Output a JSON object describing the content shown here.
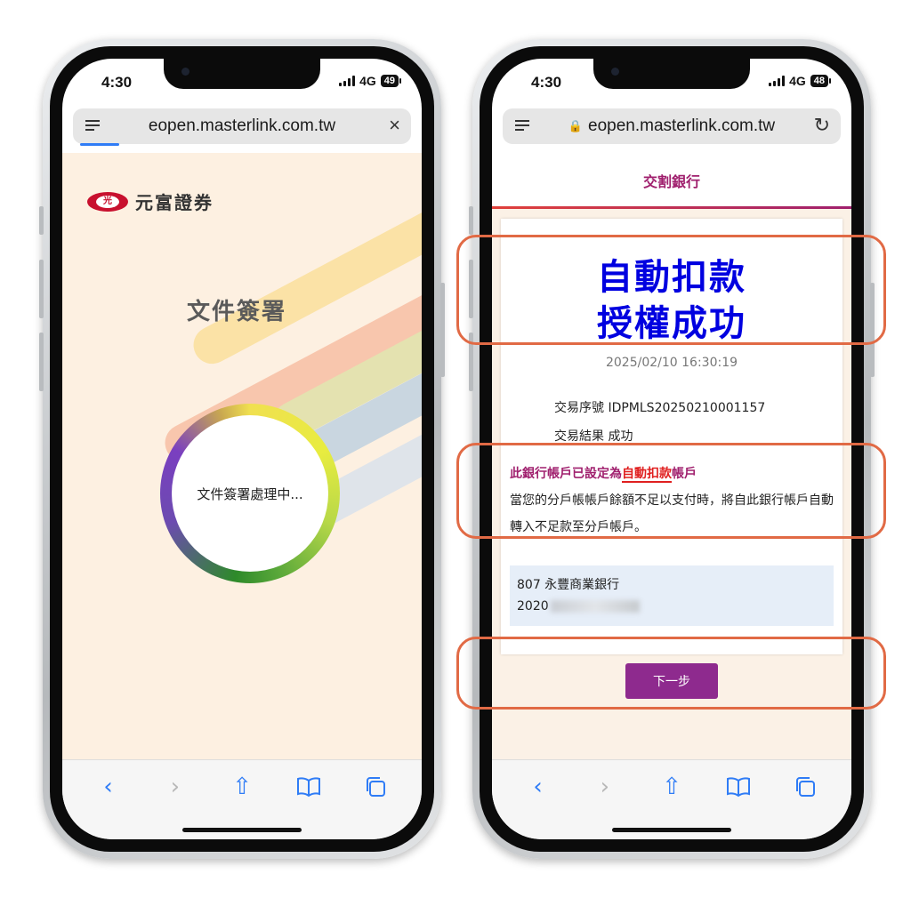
{
  "left": {
    "time": "4:30",
    "network": "4G",
    "battery": "49",
    "url": "eopen.masterlink.com.tw",
    "brand_name": "元富證券",
    "logo_text": "光",
    "title": "文件簽署",
    "processing": "文件簽署處理中..."
  },
  "right": {
    "time": "4:30",
    "network": "4G",
    "battery": "48",
    "url": "eopen.masterlink.com.tw",
    "header": "交割銀行",
    "result_line1": "自動扣款",
    "result_line2": "授權成功",
    "timestamp": "2025/02/10 16:30:19",
    "txn_id_label": "交易序號",
    "txn_id": "IDPMLS20250210001157",
    "txn_result_label": "交易結果",
    "txn_result": "成功",
    "notice_pre": "此銀行帳戶已設定為",
    "notice_hl": "自動扣款",
    "notice_post": "帳戶",
    "notice_body": "當您的分戶帳帳戶餘額不足以支付時，將自此銀行帳戶自動轉入不足款至分戶帳戶。",
    "bank_name": "807 永豐商業銀行",
    "account_prefix": "2020",
    "next_button": "下一步"
  },
  "icons": {
    "back": "‹",
    "forward": "›",
    "share": "⇧",
    "bookmarks": "📖",
    "tabs": "⧉",
    "close": "×",
    "reload": "↻",
    "lock": "🔒"
  },
  "colors": {
    "accent_blue": "#2f7cf6",
    "result_blue": "#0000e0",
    "brand_magenta": "#a0206e",
    "button_purple": "#8e2a8e",
    "highlight_orange": "#e16a45"
  }
}
